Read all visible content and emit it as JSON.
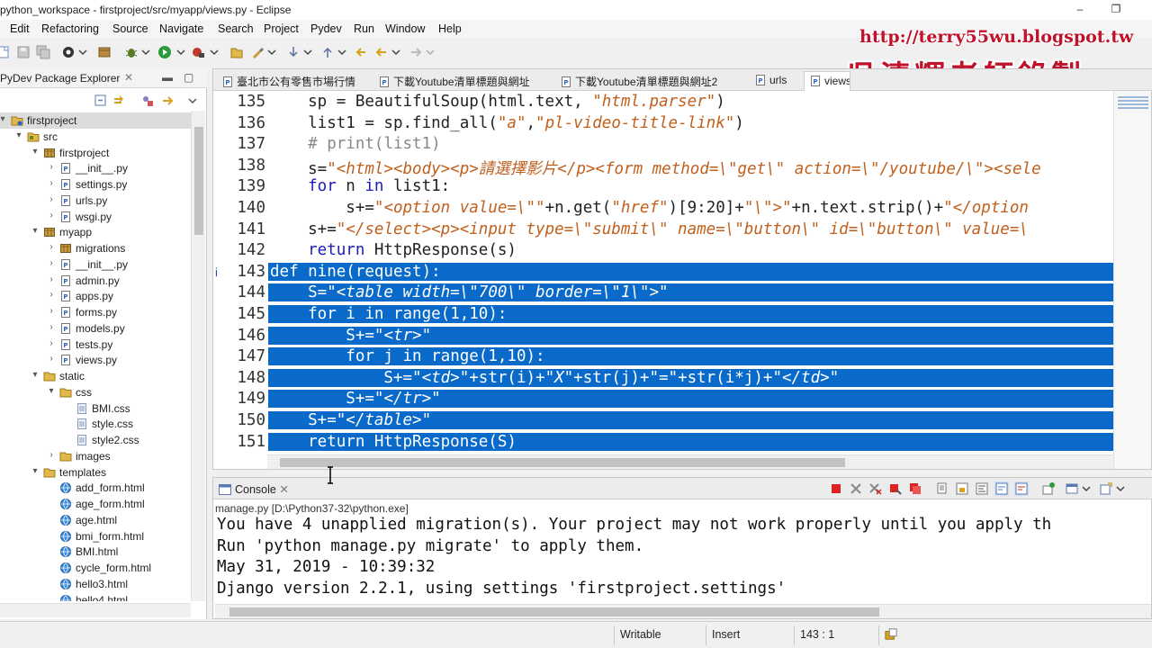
{
  "window": {
    "title": "python_workspace - firstproject/src/myapp/views.py - Eclipse",
    "minimize_glyph": "–",
    "restore_glyph": "❐"
  },
  "menu": [
    "Edit",
    "Refactoring",
    "Source",
    "Navigate",
    "Search",
    "Project",
    "Pydev",
    "Run",
    "Window",
    "Help"
  ],
  "watermark": {
    "url": "http://terry55wu.blogspot.tw",
    "title": "吳清輝老師錄製"
  },
  "explorer": {
    "tab_label": "PyDev Package Explorer",
    "close_glyph": "✕",
    "tree": [
      {
        "label": "firstproject",
        "arrow": "▾",
        "icon": "project-icon",
        "selected": true
      },
      {
        "label": "src",
        "arrow": "▾",
        "icon": "source-folder-icon"
      },
      {
        "label": "firstproject",
        "arrow": "▾",
        "icon": "package-icon"
      },
      {
        "label": "__init__.py",
        "arrow": "›",
        "icon": "python-file-icon"
      },
      {
        "label": "settings.py",
        "arrow": "›",
        "icon": "python-file-icon"
      },
      {
        "label": "urls.py",
        "arrow": "›",
        "icon": "python-file-icon"
      },
      {
        "label": "wsgi.py",
        "arrow": "›",
        "icon": "python-file-icon"
      },
      {
        "label": "myapp",
        "arrow": "▾",
        "icon": "package-icon"
      },
      {
        "label": "migrations",
        "arrow": "›",
        "icon": "package-icon"
      },
      {
        "label": "__init__.py",
        "arrow": "›",
        "icon": "python-file-icon"
      },
      {
        "label": "admin.py",
        "arrow": "›",
        "icon": "python-file-icon"
      },
      {
        "label": "apps.py",
        "arrow": "›",
        "icon": "python-file-icon"
      },
      {
        "label": "forms.py",
        "arrow": "›",
        "icon": "python-file-icon"
      },
      {
        "label": "models.py",
        "arrow": "›",
        "icon": "python-file-icon"
      },
      {
        "label": "tests.py",
        "arrow": "›",
        "icon": "python-file-icon"
      },
      {
        "label": "views.py",
        "arrow": "›",
        "icon": "python-file-icon"
      },
      {
        "label": "static",
        "arrow": "▾",
        "icon": "folder-icon"
      },
      {
        "label": "css",
        "arrow": "▾",
        "icon": "folder-icon"
      },
      {
        "label": "BMI.css",
        "arrow": "",
        "icon": "css-file-icon"
      },
      {
        "label": "style.css",
        "arrow": "",
        "icon": "css-file-icon"
      },
      {
        "label": "style2.css",
        "arrow": "",
        "icon": "css-file-icon"
      },
      {
        "label": "images",
        "arrow": "›",
        "icon": "folder-icon"
      },
      {
        "label": "templates",
        "arrow": "▾",
        "icon": "folder-icon"
      },
      {
        "label": "add_form.html",
        "arrow": "",
        "icon": "html-file-icon"
      },
      {
        "label": "age_form.html",
        "arrow": "",
        "icon": "html-file-icon"
      },
      {
        "label": "age.html",
        "arrow": "",
        "icon": "html-file-icon"
      },
      {
        "label": "bmi_form.html",
        "arrow": "",
        "icon": "html-file-icon"
      },
      {
        "label": "BMI.html",
        "arrow": "",
        "icon": "html-file-icon"
      },
      {
        "label": "cycle_form.html",
        "arrow": "",
        "icon": "html-file-icon"
      },
      {
        "label": "hello3.html",
        "arrow": "",
        "icon": "html-file-icon"
      },
      {
        "label": "hello4.html",
        "arrow": "",
        "icon": "html-file-icon"
      }
    ]
  },
  "editor": {
    "tabs": [
      "臺北市公有零售市場行情",
      "下載Youtube清單標題與網址",
      "下載Youtube清單標題與網址2",
      "urls",
      "views"
    ],
    "active_tab": 4,
    "lines": [
      {
        "num": "135",
        "segs": [
          [
            "",
            "    sp = BeautifulSoup(html.text, "
          ],
          [
            "str",
            "\"html.parser\""
          ],
          [
            "",
            ")"
          ]
        ]
      },
      {
        "num": "136",
        "segs": [
          [
            "",
            "    list1 = sp.find_all("
          ],
          [
            "str",
            "\"a\""
          ],
          [
            "",
            ","
          ],
          [
            "str",
            "\"pl-video-title-link\""
          ],
          [
            "",
            ")"
          ]
        ]
      },
      {
        "num": "137",
        "segs": [
          [
            "cm",
            "    # print(list1)"
          ]
        ]
      },
      {
        "num": "138",
        "segs": [
          [
            "",
            "    s="
          ],
          [
            "str",
            "\"<html><body><p>請選擇影片</p><form method=\\\"get\\\" action=\\\"/youtube/\\\"><sele"
          ]
        ]
      },
      {
        "num": "139",
        "segs": [
          [
            "kw",
            "    for"
          ],
          [
            "",
            " n "
          ],
          [
            "kw",
            "in"
          ],
          [
            "",
            " list1:"
          ]
        ]
      },
      {
        "num": "140",
        "segs": [
          [
            "",
            "        s+="
          ],
          [
            "str",
            "\"<option value=\\\"\""
          ],
          [
            "",
            "+n.get("
          ],
          [
            "str",
            "\"href\""
          ],
          [
            "",
            ")[9:20]+"
          ],
          [
            "str",
            "\"\\\">\""
          ],
          [
            "",
            "+n.text.strip()+"
          ],
          [
            "str",
            "\"</option"
          ]
        ]
      },
      {
        "num": "141",
        "segs": [
          [
            "",
            "    s+="
          ],
          [
            "str",
            "\"</select><p><input type=\\\"submit\\\" name=\\\"button\\\" id=\\\"button\\\" value=\\"
          ]
        ]
      },
      {
        "num": "142",
        "segs": [
          [
            "kw",
            "    return"
          ],
          [
            "",
            " HttpResponse(s)"
          ]
        ]
      },
      {
        "num": "143",
        "sel": true,
        "marker": "i",
        "segs": [
          [
            "kw",
            "def"
          ],
          [
            "",
            " nine(request):"
          ]
        ]
      },
      {
        "num": "144",
        "sel": true,
        "segs": [
          [
            "",
            "    S="
          ],
          [
            "str",
            "\"<table width=\\\"700\\\" border=\\\"1\\\">\""
          ]
        ]
      },
      {
        "num": "145",
        "sel": true,
        "segs": [
          [
            "kw",
            "    for"
          ],
          [
            "",
            " i "
          ],
          [
            "kw",
            "in"
          ],
          [
            "",
            " range(1,10):"
          ]
        ]
      },
      {
        "num": "146",
        "sel": true,
        "segs": [
          [
            "",
            "        S+="
          ],
          [
            "str",
            "\"<tr>\""
          ]
        ]
      },
      {
        "num": "147",
        "sel": true,
        "segs": [
          [
            "kw",
            "        for"
          ],
          [
            "",
            " j "
          ],
          [
            "kw",
            "in"
          ],
          [
            "",
            " range(1,10):"
          ]
        ]
      },
      {
        "num": "148",
        "sel": true,
        "segs": [
          [
            "",
            "            S+="
          ],
          [
            "str",
            "\"<td>\""
          ],
          [
            "",
            "+str(i)+"
          ],
          [
            "str",
            "\"X\""
          ],
          [
            "",
            "+str(j)+"
          ],
          [
            "str",
            "\"=\""
          ],
          [
            "",
            "+str(i*j)+"
          ],
          [
            "str",
            "\"</td>\""
          ]
        ]
      },
      {
        "num": "149",
        "sel": true,
        "segs": [
          [
            "",
            "        S+="
          ],
          [
            "str",
            "\"</tr>\""
          ]
        ]
      },
      {
        "num": "150",
        "sel": true,
        "segs": [
          [
            "",
            "    S+="
          ],
          [
            "str",
            "\"</table>\""
          ]
        ]
      },
      {
        "num": "151",
        "sel": true,
        "segs": [
          [
            "kw",
            "    return"
          ],
          [
            "",
            " HttpResponse(S)"
          ]
        ]
      }
    ]
  },
  "console": {
    "tab_label": "Console",
    "process": "manage.py [D:\\Python37-32\\python.exe]",
    "output": [
      "You have 4 unapplied migration(s). Your project may not work properly until you apply th",
      "Run 'python manage.py migrate' to apply them.",
      "May 31, 2019 - 10:39:32",
      "Django version 2.2.1, using settings 'firstproject.settings'"
    ]
  },
  "status": {
    "writable": "Writable",
    "insert": "Insert",
    "position": "143 : 1"
  },
  "colors": {
    "selection": "#0a6ac9",
    "keyword": "#1c1cb8",
    "string": "#c0601e",
    "watermark": "#c0122a"
  }
}
